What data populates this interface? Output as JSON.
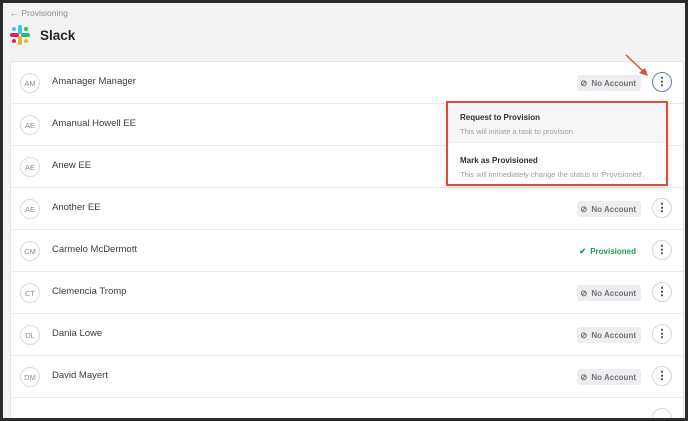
{
  "nav": {
    "back_label": "Provisioning"
  },
  "header": {
    "title": "Slack"
  },
  "users": [
    {
      "initials": "AM",
      "name": "Amanager Manager",
      "status": "No Account"
    },
    {
      "initials": "AE",
      "name": "Amanual Howell EE",
      "status": ""
    },
    {
      "initials": "AE",
      "name": "Anew EE",
      "status": ""
    },
    {
      "initials": "AE",
      "name": "Another EE",
      "status": "No Account"
    },
    {
      "initials": "CM",
      "name": "Carmelo McDermott",
      "status": "Provisioned"
    },
    {
      "initials": "CT",
      "name": "Clemencia Tromp",
      "status": "No Account"
    },
    {
      "initials": "DL",
      "name": "Dania Lowe",
      "status": "No Account"
    },
    {
      "initials": "DM",
      "name": "David Mayert",
      "status": "No Account"
    }
  ],
  "menu": {
    "items": [
      {
        "title": "Request to Provision",
        "description": "This will initiate a task to provision"
      },
      {
        "title": "Mark as Provisioned",
        "description": "This will immediately change the status to 'Provisioned'."
      }
    ]
  },
  "colors": {
    "provisioned": "#1e9e52",
    "highlight": "#e04a3a"
  },
  "icons": {
    "no_account": "block-icon",
    "provisioned": "check-circle-icon",
    "menu": "kebab-icon"
  }
}
